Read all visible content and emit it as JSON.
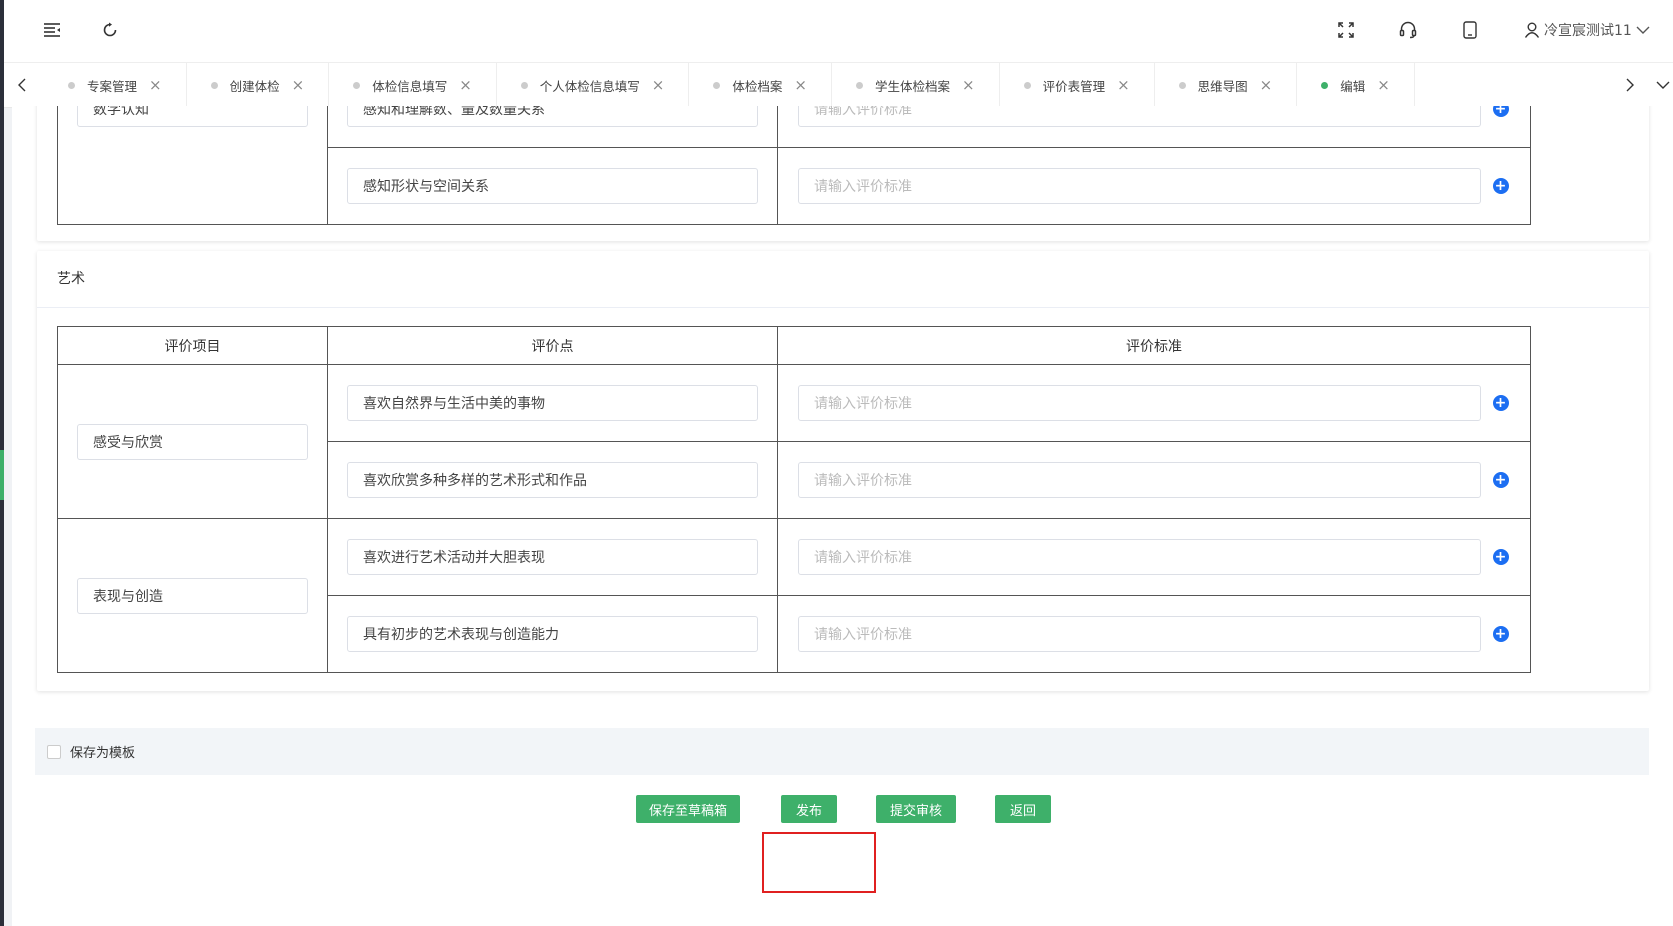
{
  "header": {
    "user_name": "冷宣宸测试11",
    "icons": [
      "menu-fold-icon",
      "refresh-icon",
      "fullscreen-icon",
      "headset-icon",
      "tablet-icon",
      "user-icon",
      "chevron-down-icon"
    ]
  },
  "tabs": [
    {
      "label": "专案管理",
      "active": false
    },
    {
      "label": "创建体检",
      "active": false
    },
    {
      "label": "体检信息填写",
      "active": false
    },
    {
      "label": "个人体检信息填写",
      "active": false
    },
    {
      "label": "体检档案",
      "active": false
    },
    {
      "label": "学生体检档案",
      "active": false
    },
    {
      "label": "评价表管理",
      "active": false
    },
    {
      "label": "思维导图",
      "active": false
    },
    {
      "label": "编辑",
      "active": true
    }
  ],
  "prev_card": {
    "item_value": "数学认知",
    "rows": [
      {
        "point": "感知和理解数、量及数量关系",
        "standard_placeholder": "请输入评价标准"
      },
      {
        "point": "感知形状与空间关系",
        "standard_placeholder": "请输入评价标准"
      }
    ]
  },
  "art_card": {
    "title": "艺术",
    "columns": [
      "评价项目",
      "评价点",
      "评价标准"
    ],
    "groups": [
      {
        "item": "感受与欣赏",
        "points": [
          {
            "point": "喜欢自然界与生活中美的事物",
            "standard_placeholder": "请输入评价标准"
          },
          {
            "point": "喜欢欣赏多种多样的艺术形式和作品",
            "standard_placeholder": "请输入评价标准"
          }
        ]
      },
      {
        "item": "表现与创造",
        "points": [
          {
            "point": "喜欢进行艺术活动并大胆表现",
            "standard_placeholder": "请输入评价标准"
          },
          {
            "point": "具有初步的艺术表现与创造能力",
            "standard_placeholder": "请输入评价标准"
          }
        ]
      }
    ]
  },
  "footer": {
    "save_template_label": "保存为模板",
    "save_template_checked": false,
    "buttons": {
      "draft": "保存至草稿箱",
      "publish": "发布",
      "submit": "提交审核",
      "back": "返回"
    }
  },
  "colors": {
    "primary_green": "#3eb06a",
    "plus_blue": "#1c6ef2",
    "highlight_red": "#e02020"
  }
}
